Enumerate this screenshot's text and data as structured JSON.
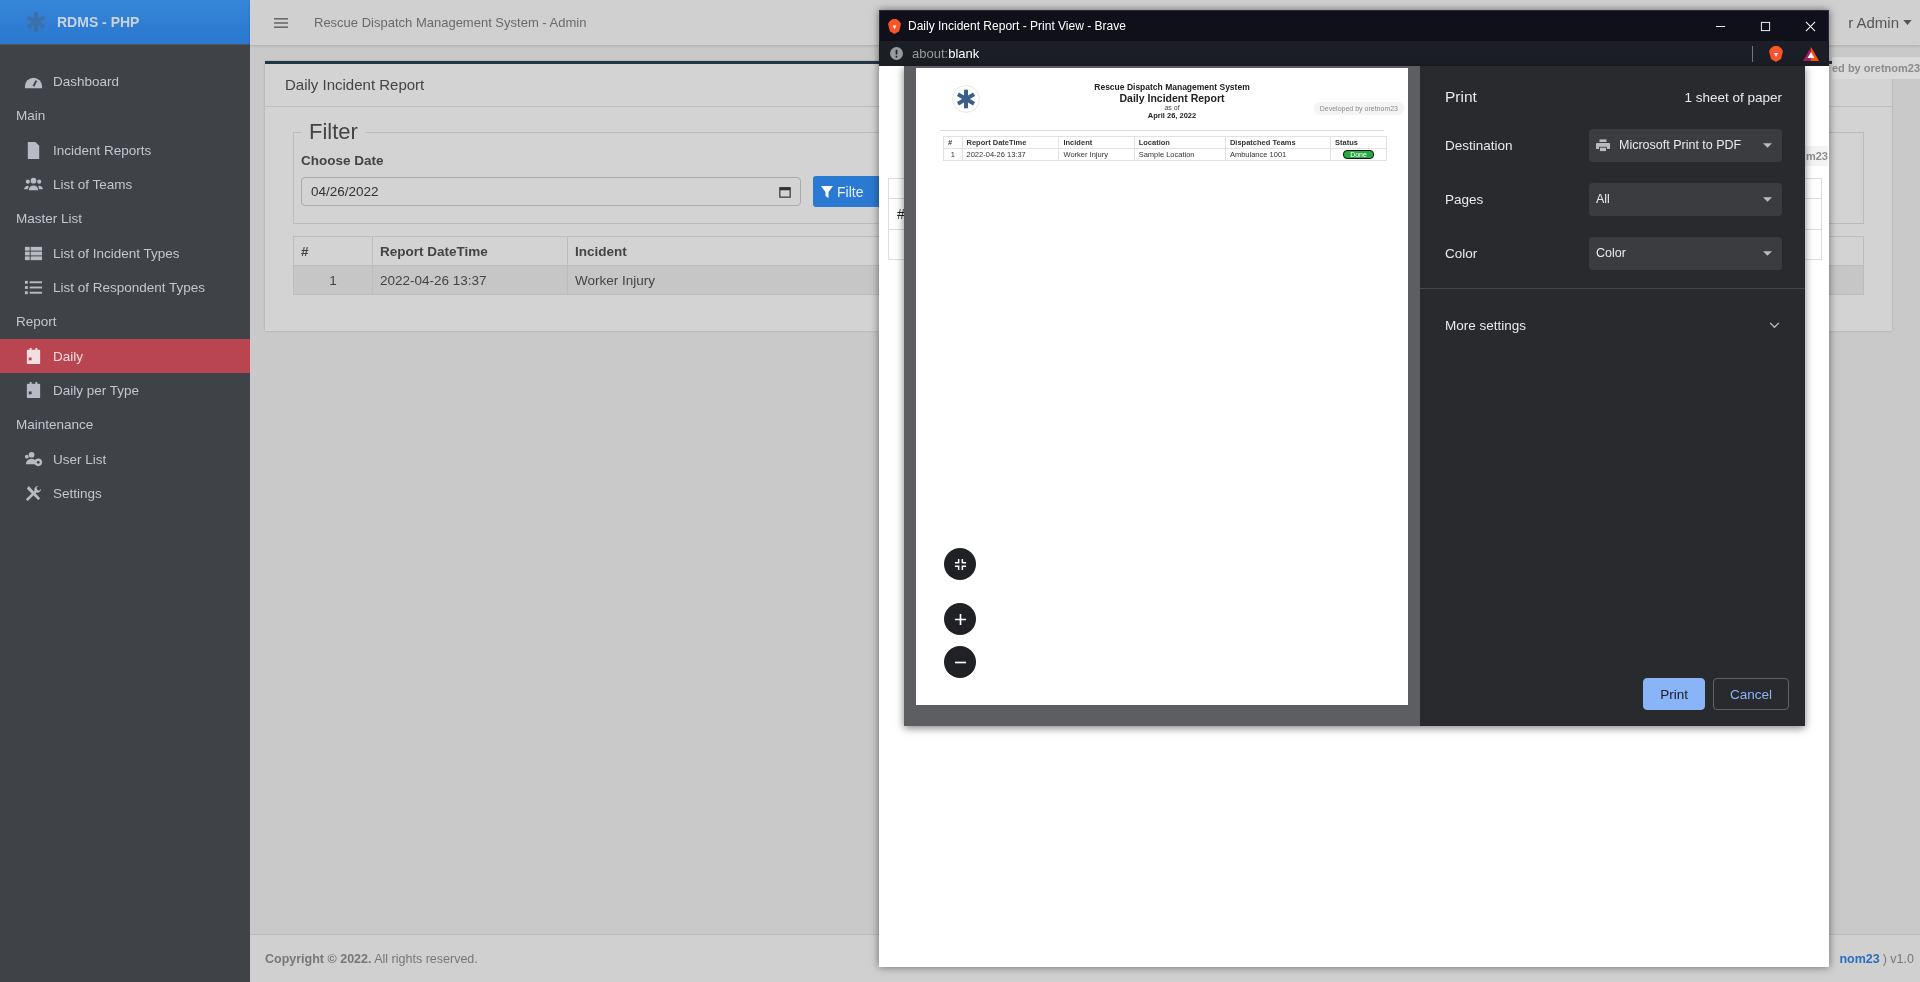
{
  "app": {
    "brand": "RDMS - PHP",
    "header_title": "Rescue Dispatch Management System - Admin",
    "user_menu": "r Admin",
    "developer_badge": "ed by oretnom23"
  },
  "sidebar": {
    "items": [
      {
        "kind": "link",
        "label": "Dashboard",
        "selected": false
      },
      {
        "kind": "header",
        "label": "Main"
      },
      {
        "kind": "link",
        "label": "Incident Reports",
        "selected": false
      },
      {
        "kind": "link",
        "label": "List of Teams",
        "selected": false
      },
      {
        "kind": "header",
        "label": "Master List"
      },
      {
        "kind": "link",
        "label": "List of Incident Types",
        "selected": false
      },
      {
        "kind": "link",
        "label": "List of Respondent Types",
        "selected": false
      },
      {
        "kind": "header",
        "label": "Report"
      },
      {
        "kind": "link",
        "label": "Daily",
        "selected": true
      },
      {
        "kind": "link",
        "label": "Daily per Type",
        "selected": false
      },
      {
        "kind": "header",
        "label": "Maintenance"
      },
      {
        "kind": "link",
        "label": "User List",
        "selected": false
      },
      {
        "kind": "link",
        "label": "Settings",
        "selected": false
      }
    ]
  },
  "card": {
    "title": "Daily Incident Report",
    "filter": {
      "legend": "Filter",
      "label": "Choose Date",
      "value": "04/26/2022",
      "button": "Filte"
    },
    "table": {
      "columns": [
        "#",
        "Report DateTime",
        "Incident"
      ],
      "rows": [
        [
          "1",
          "2022-04-26 13:37",
          "Worker Injury"
        ]
      ]
    }
  },
  "footer": {
    "copyright": "**Copyright © 2022.** All rights reserved.",
    "link": "nom23",
    "version": ") v1.0"
  },
  "window": {
    "title": "Daily Incident Report - Print View - Brave",
    "address": {
      "scheme": "about:",
      "path": "blank"
    },
    "page_fragments": {
      "cell": "#",
      "badge": "m23"
    },
    "preview": {
      "org": "Rescue Dispatch Management System",
      "title": "Daily Incident Report",
      "as_of": "as of",
      "date": "April 26, 2022",
      "badge": "Developed by oretnom23",
      "columns": [
        "#",
        "Report DateTime",
        "Incident",
        "Location",
        "Dispatched Teams",
        "Status"
      ],
      "rows": [
        {
          "cells": [
            "1",
            "2022-04-26 13:37",
            "Worker Injury",
            "Sample Location",
            "Ambulance 1001"
          ],
          "status": "Done"
        }
      ]
    },
    "print": {
      "title": "Print",
      "sheets": "1 sheet of paper",
      "fields": [
        {
          "label": "Destination",
          "value": "Microsoft Print to PDF",
          "kind": "printer"
        },
        {
          "label": "Pages",
          "value": "All",
          "kind": "plain"
        },
        {
          "label": "Color",
          "value": "Color",
          "kind": "plain"
        }
      ],
      "more_settings": "More settings",
      "buttons": [
        {
          "label": "Print",
          "kind": "primary"
        },
        {
          "label": "Cancel",
          "kind": "secondary"
        }
      ]
    }
  }
}
